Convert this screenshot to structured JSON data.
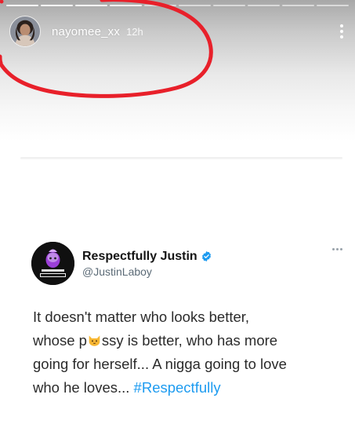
{
  "story": {
    "username": "nayomee_xx",
    "timestamp": "12h",
    "segments": 10,
    "active_segments": 4
  },
  "tweet": {
    "display_name": "Respectfully Justin",
    "handle": "@JustinLaboy",
    "verified": true,
    "avatar_caption_top": "JUSTIN LABOY",
    "avatar_caption_bottom": "#RESPECTFULLY",
    "text_line_1": "It doesn't matter who looks better,",
    "text_line_2_before": "whose p",
    "text_line_2_emoji": "cat-face-emoji",
    "text_line_2_after": "ssy is better, who has more",
    "text_line_3": "going for herself... A nigga going to love",
    "text_line_4": "who he loves... ",
    "hashtag": "#Respectfully"
  },
  "colors": {
    "hashtag": "#1d9bf0",
    "verified_badge": "#1d9bf0",
    "annotation_stroke": "#e8202a",
    "text": "#2b2b2b"
  },
  "icons": {
    "verified": "verified-badge-icon",
    "story_menu": "more-vertical-icon",
    "tweet_menu": "more-horizontal-icon"
  }
}
